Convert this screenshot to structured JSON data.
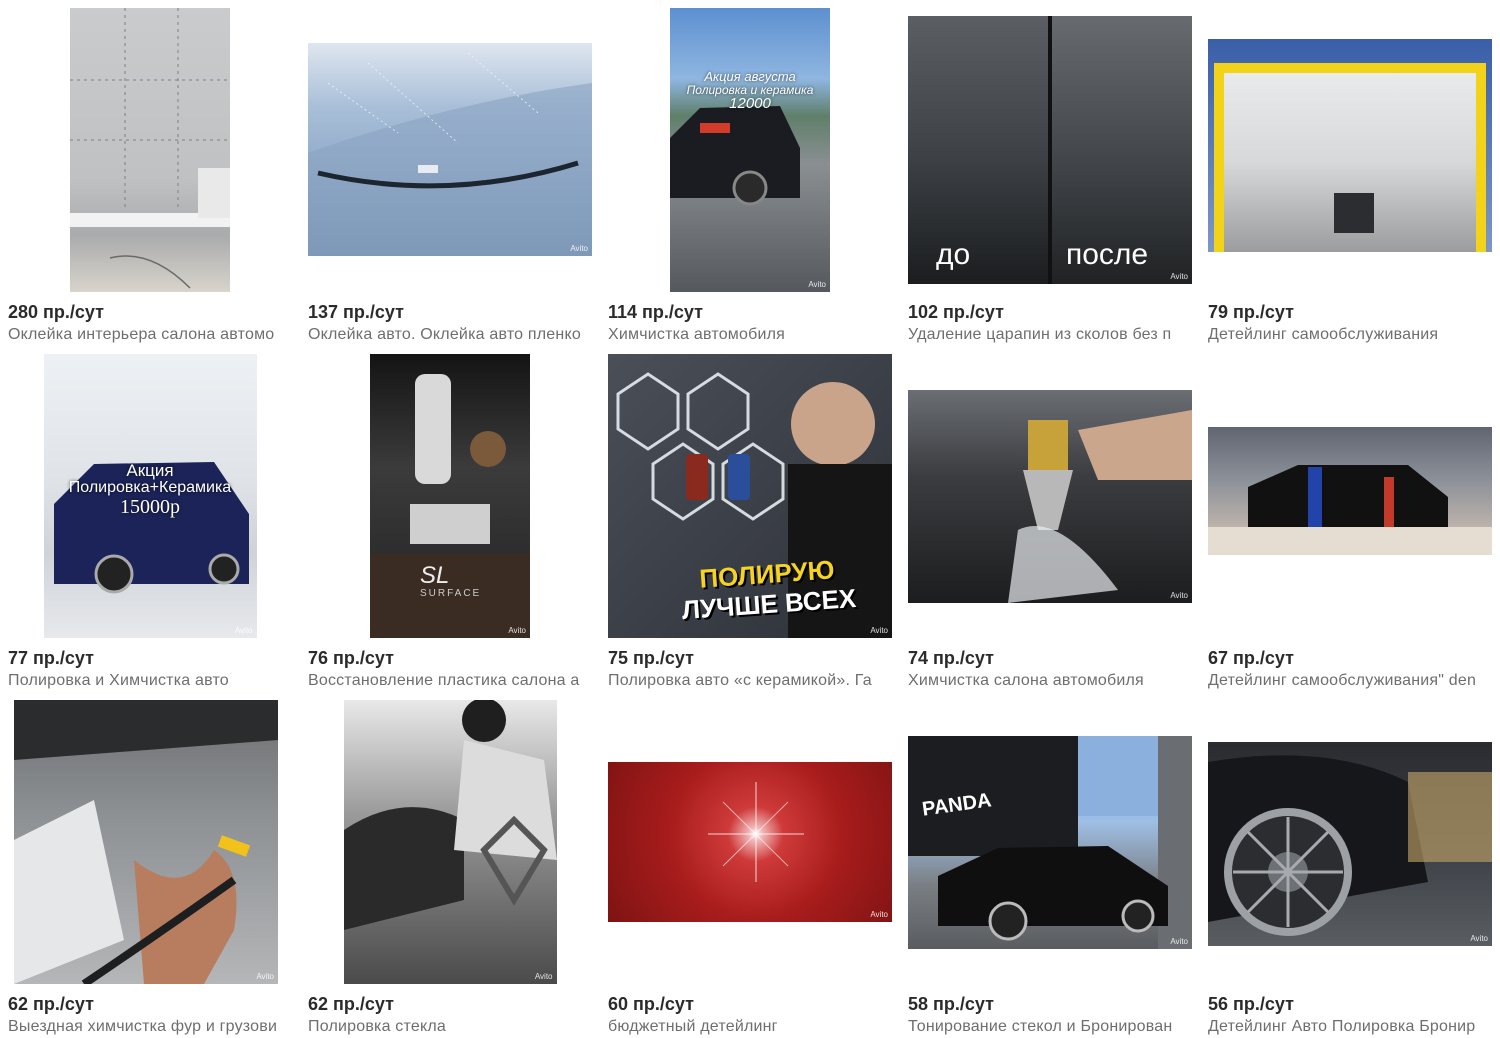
{
  "watermark": "Avito",
  "cards": [
    {
      "price": "280 пр./сут",
      "title": "Оклейка интерьера салона автомо"
    },
    {
      "price": "137 пр./сут",
      "title": "Оклейка авто. Оклейка авто пленко"
    },
    {
      "price": "114 пр./сут",
      "title": "Химчистка автомобиля",
      "overlay": [
        "Акция августа",
        "Полировка и керамика",
        "12000"
      ]
    },
    {
      "price": "102 пр./сут",
      "title": "Удаление царапин из сколов без п",
      "overlay": [
        "до",
        "после"
      ]
    },
    {
      "price": "79 пр./сут",
      "title": "Детейлинг самообслуживания"
    },
    {
      "price": "77 пр./сут",
      "title": "Полировка и Химчистка авто",
      "overlay": [
        "Акция",
        "Полировка+Керамика",
        "15000р"
      ]
    },
    {
      "price": "76 пр./сут",
      "title": "Восстановление пластика салона а",
      "overlay": [
        "SL",
        "SURFACE"
      ]
    },
    {
      "price": "75 пр./сут",
      "title": "Полировка авто «с керамикой». Га",
      "overlay": [
        "ПОЛИРУЮ",
        "ЛУЧШЕ ВСЕХ"
      ]
    },
    {
      "price": "74 пр./сут",
      "title": "Химчистка салона автомобиля"
    },
    {
      "price": "67 пр./сут",
      "title": "Детейлинг самообслуживания\" den"
    },
    {
      "price": "62 пр./сут",
      "title": "Выездная химчистка фур и грузови"
    },
    {
      "price": "62 пр./сут",
      "title": "Полировка стекла"
    },
    {
      "price": "60 пр./сут",
      "title": "бюджетный детейлинг"
    },
    {
      "price": "58 пр./сут",
      "title": "Тонирование стекол и Бронирован",
      "overlay": [
        "PANDA"
      ]
    },
    {
      "price": "56 пр./сут",
      "title": "Детейлинг Авто Полировка Бронир"
    }
  ]
}
